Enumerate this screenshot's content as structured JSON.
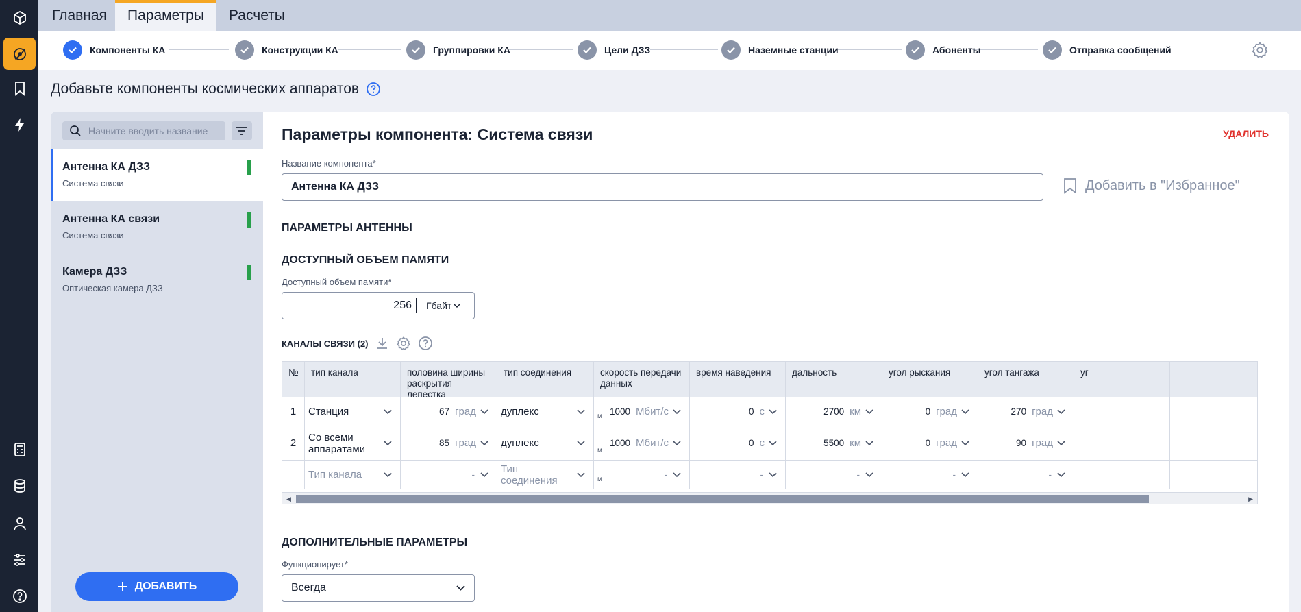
{
  "tabs": [
    {
      "label": "Главная",
      "active": false
    },
    {
      "label": "Параметры",
      "active": true
    },
    {
      "label": "Расчеты",
      "active": false
    }
  ],
  "stepper": [
    {
      "label": "Компоненты КА",
      "current": true
    },
    {
      "label": "Конструкции КА",
      "current": false
    },
    {
      "label": "Группировки КА",
      "current": false
    },
    {
      "label": "Цели ДЗЗ",
      "current": false
    },
    {
      "label": "Наземные станции",
      "current": false
    },
    {
      "label": "Абоненты",
      "current": false
    },
    {
      "label": "Отправка сообщений",
      "current": false
    }
  ],
  "rail_icons": [
    "cube-icon",
    "orbit-icon",
    "bookmark-icon",
    "lightning-icon",
    "calculator-icon",
    "database-icon",
    "user-icon",
    "sliders-icon",
    "help-icon"
  ],
  "page": {
    "title": "Добавьте компоненты космических аппаратов"
  },
  "sidebar": {
    "search_placeholder": "Начните вводить название",
    "items": [
      {
        "title": "Антенна КА ДЗЗ",
        "subtitle": "Система связи",
        "selected": true
      },
      {
        "title": "Антенна КА связи",
        "subtitle": "Система связи",
        "selected": false
      },
      {
        "title": "Камера ДЗЗ",
        "subtitle": "Оптическая камера ДЗЗ",
        "selected": false
      }
    ],
    "add_label": "ДОБАВИТЬ"
  },
  "main": {
    "title": "Параметры компонента: Система связи",
    "delete_label": "УДАЛИТЬ",
    "name_label": "Название компонента*",
    "name_value": "Антенна КА ДЗЗ",
    "favorite_label": "Добавить в \"Избранное\"",
    "antenna_section": "ПАРАМЕТРЫ АНТЕННЫ",
    "memory_section": "ДОСТУПНЫЙ ОБЪЕМ ПАМЯТИ",
    "memory_label": "Доступный объем памяти*",
    "memory_value": "256",
    "memory_unit": "Гбайт",
    "channels_title": "КАНАЛЫ СВЯЗИ (2)",
    "extra_section": "ДОПОЛНИТЕЛЬНЫЕ ПАРАМЕТРЫ",
    "functions_label": "Функционирует*",
    "functions_value": "Всегда"
  },
  "table": {
    "headers": [
      "№",
      "тип канала",
      "половина ширины раскрытия лепестка",
      "тип соединения",
      "скорость передачи данных",
      "время наведения",
      "дальность",
      "угол рыскания",
      "угол тангажа",
      "уг"
    ],
    "rows": [
      {
        "n": "1",
        "type": "Станция",
        "half_width": "67",
        "half_width_unit": "град",
        "connection": "дуплекс",
        "m": "м",
        "speed": "1000",
        "speed_unit": "Мбит/с",
        "aim_time": "0",
        "aim_unit": "с",
        "range": "2700",
        "range_unit": "км",
        "yaw": "0",
        "yaw_unit": "град",
        "pitch": "270",
        "pitch_unit": "град"
      },
      {
        "n": "2",
        "type": "Со всеми аппаратами",
        "half_width": "85",
        "half_width_unit": "град",
        "connection": "дуплекс",
        "m": "м",
        "speed": "1000",
        "speed_unit": "Мбит/с",
        "aim_time": "0",
        "aim_unit": "с",
        "range": "5500",
        "range_unit": "км",
        "yaw": "0",
        "yaw_unit": "град",
        "pitch": "90",
        "pitch_unit": "град"
      }
    ],
    "new_row": {
      "type_placeholder": "Тип канала",
      "connection_placeholder": "Тип соединения",
      "m": "м",
      "dash": "-"
    }
  },
  "colors": {
    "accent": "#2f6ef2",
    "rail": "#1b2333",
    "active_tab": "#f5a623",
    "delete": "#e0312c",
    "status_ok": "#28a04b"
  }
}
